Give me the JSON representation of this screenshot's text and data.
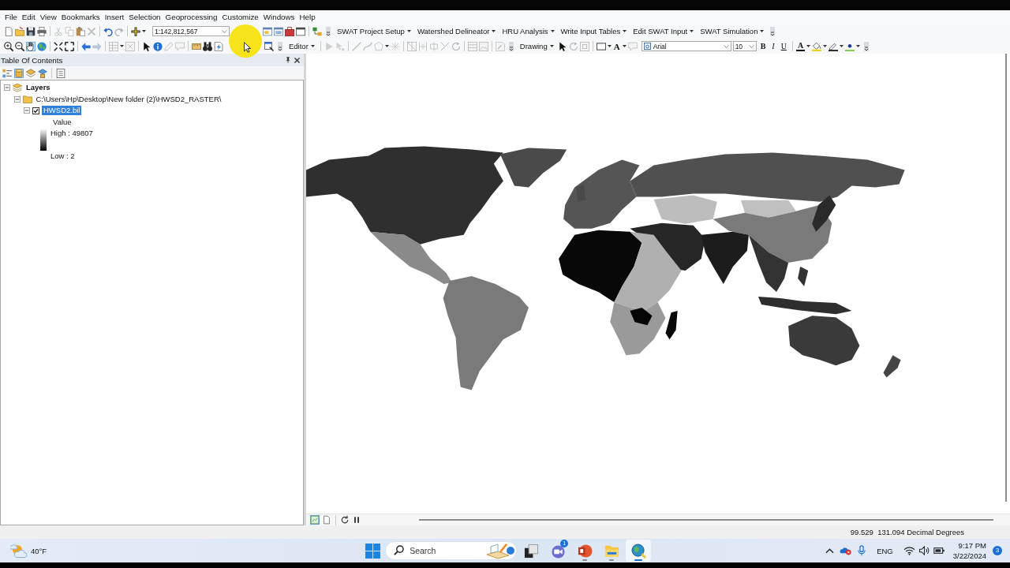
{
  "menu": [
    "File",
    "Edit",
    "View",
    "Bookmarks",
    "Insert",
    "Selection",
    "Geoprocessing",
    "Customize",
    "Windows",
    "Help"
  ],
  "standard_toolbar": {
    "scale": "1:142,812,567"
  },
  "swat_menus": [
    "SWAT Project Setup",
    "Watershed Delineator",
    "HRU Analysis",
    "Write Input Tables",
    "Edit SWAT Input",
    "SWAT Simulation"
  ],
  "tools_toolbar": {
    "buttons": [
      {
        "selected": false
      },
      {
        "selected": false
      },
      {
        "selected": true
      },
      {
        "selected": false
      }
    ]
  },
  "editor_menu": "Editor",
  "draw_toolbar": {
    "menu": "Drawing",
    "text_tool": "A",
    "font": "Arial",
    "font_size": "10",
    "format_buttons": [
      "B",
      "I",
      "U"
    ],
    "font_color": "A"
  },
  "toc": {
    "title": "Table Of Contents",
    "view_buttons": [
      {
        "selected": false
      },
      {
        "selected": true
      },
      {
        "selected": false
      },
      {
        "selected": false
      },
      {
        "selected": false
      }
    ],
    "tree": [
      {
        "kind": "data_frame",
        "label": "Layers",
        "expanded": true,
        "selected": false,
        "children": [
          {
            "kind": "workspace",
            "label": "C:\\Users\\Hp\\Desktop\\New folder (2)\\HWSD2_RASTER\\",
            "expanded": true,
            "selected": false,
            "children": [
              {
                "kind": "raster_layer",
                "label": "HWSD2.bil",
                "expanded": true,
                "selected": true,
                "checked": true,
                "legend": {
                  "field": "Value",
                  "high": "High : 49807",
                  "low": "Low : 2"
                }
              }
            ]
          }
        ]
      }
    ]
  },
  "map": {
    "view_buttons": [
      {
        "selected": true
      },
      {
        "selected": false
      }
    ]
  },
  "status_bar": {
    "coordinates": "99.529  131.094 Decimal Degrees"
  },
  "taskbar": {
    "weather": "40°F",
    "search": {
      "placeholder": "Search"
    },
    "apps": [
      {
        "running": false,
        "active": false
      },
      {
        "running": false,
        "active": false,
        "badge": "1"
      },
      {
        "running": true,
        "active": false
      },
      {
        "running": true,
        "active": false
      },
      {
        "running": true,
        "active": true
      }
    ],
    "language": "ENG",
    "time": "9:17 PM",
    "date": "3/22/2024",
    "notifications": "3"
  }
}
